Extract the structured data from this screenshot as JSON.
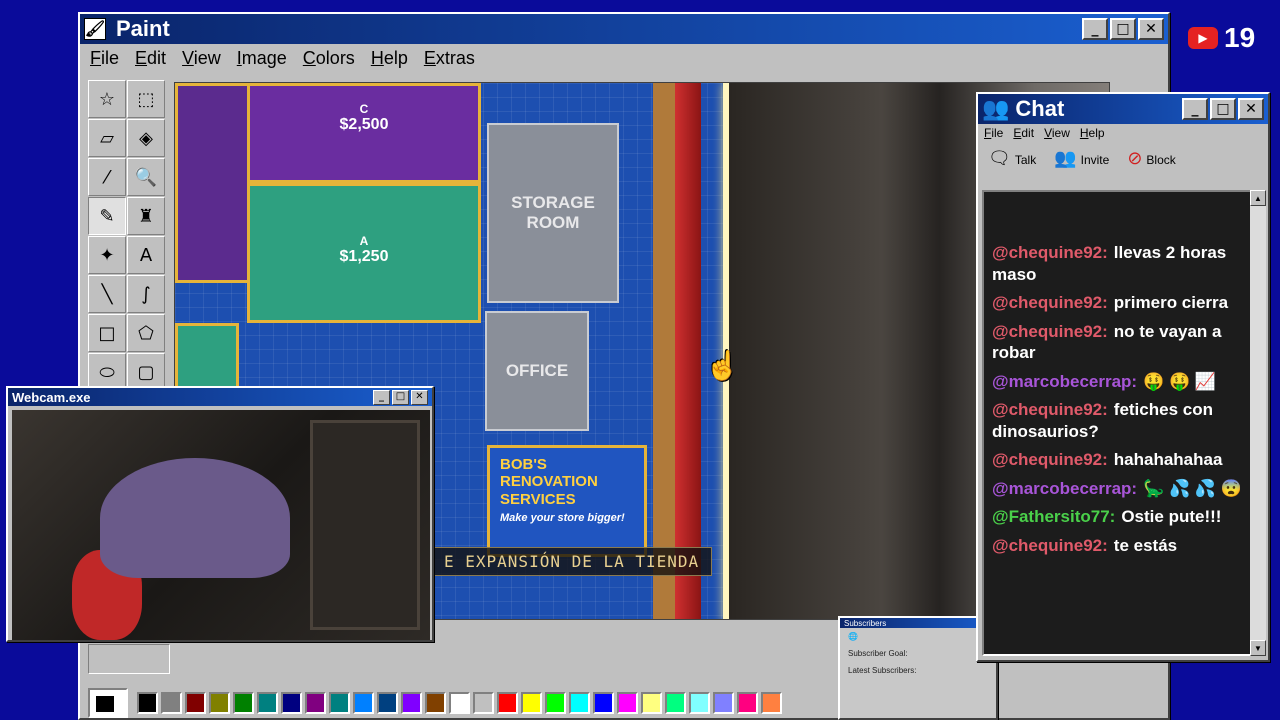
{
  "paint": {
    "title": "Paint",
    "menu": [
      "File",
      "Edit",
      "View",
      "Image",
      "Colors",
      "Help",
      "Extras"
    ],
    "tools": [
      {
        "name": "free-select-icon",
        "glyph": "☆"
      },
      {
        "name": "rect-select-icon",
        "glyph": "⬚"
      },
      {
        "name": "eraser-icon",
        "glyph": "▱"
      },
      {
        "name": "fill-bucket-icon",
        "glyph": "◈"
      },
      {
        "name": "color-picker-icon",
        "glyph": "⁄"
      },
      {
        "name": "magnifier-icon",
        "glyph": "🔍"
      },
      {
        "name": "pencil-icon",
        "glyph": "✎"
      },
      {
        "name": "brush-icon",
        "glyph": "♜"
      },
      {
        "name": "airbrush-icon",
        "glyph": "✦"
      },
      {
        "name": "text-icon",
        "glyph": "A"
      },
      {
        "name": "line-icon",
        "glyph": "╲"
      },
      {
        "name": "curve-icon",
        "glyph": "∫"
      },
      {
        "name": "rectangle-icon",
        "glyph": "□"
      },
      {
        "name": "polygon-icon",
        "glyph": "⬠"
      },
      {
        "name": "ellipse-icon",
        "glyph": "⬭"
      },
      {
        "name": "rounded-rect-icon",
        "glyph": "▢"
      }
    ],
    "palette": [
      "#000000",
      "#808080",
      "#800000",
      "#808000",
      "#008000",
      "#008080",
      "#000080",
      "#800080",
      "#008080",
      "#0080ff",
      "#004080",
      "#8000ff",
      "#804000",
      "#ffffff",
      "#c0c0c0",
      "#ff0000",
      "#ffff00",
      "#00ff00",
      "#00ffff",
      "#0000ff",
      "#ff00ff",
      "#ffff80",
      "#00ff80",
      "#80ffff",
      "#8080ff",
      "#ff0080",
      "#ff8040"
    ]
  },
  "scene": {
    "room_c_letter": "C",
    "room_c_price": "$2,500",
    "room_a_letter": "A",
    "room_a_price": "$1,250",
    "storage_label": "STORAGE ROOM",
    "office_label": "OFFICE",
    "ad_title": "BOB'S RENOVATION SERVICES",
    "ad_sub": "Make your store bigger!",
    "subtitle": "E EXPANSIÓN DE LA TIENDA"
  },
  "chat": {
    "title": "Chat",
    "menu": [
      "File",
      "Edit",
      "View",
      "Help"
    ],
    "actions": [
      {
        "label": "Talk",
        "icon": "talk-icon",
        "glyph": "🗨"
      },
      {
        "label": "Invite",
        "icon": "invite-icon",
        "glyph": "👥"
      },
      {
        "label": "Block",
        "icon": "block-icon",
        "glyph": "⊘"
      }
    ],
    "messages": [
      {
        "user": "@chequine92:",
        "color": "#e05a6a",
        "text": "llevas 2 horas maso"
      },
      {
        "user": "@chequine92:",
        "color": "#e05a6a",
        "text": "primero cierra"
      },
      {
        "user": "@chequine92:",
        "color": "#e05a6a",
        "text": "no te vayan a robar"
      },
      {
        "user": "@marcobecerrap:",
        "color": "#a855d8",
        "text": "🤑 🤑 📈"
      },
      {
        "user": "@chequine92:",
        "color": "#e05a6a",
        "text": "fetiches con dinosaurios?"
      },
      {
        "user": "@chequine92:",
        "color": "#e05a6a",
        "text": "hahahahahaa"
      },
      {
        "user": "@marcobecerrap:",
        "color": "#a855d8",
        "text": "🦕 💦 💦 😨"
      },
      {
        "user": "@Fathersito77:",
        "color": "#4ad04a",
        "text": "Ostie pute!!!"
      },
      {
        "user": "@chequine92:",
        "color": "#e05a6a",
        "text": "te estás"
      }
    ]
  },
  "webcam": {
    "title": "Webcam.exe"
  },
  "subscribers": {
    "title": "Subscribers",
    "goal_label": "Subscriber Goal:",
    "latest_label": "Latest Subscribers:"
  },
  "youtube": {
    "count": "19"
  }
}
